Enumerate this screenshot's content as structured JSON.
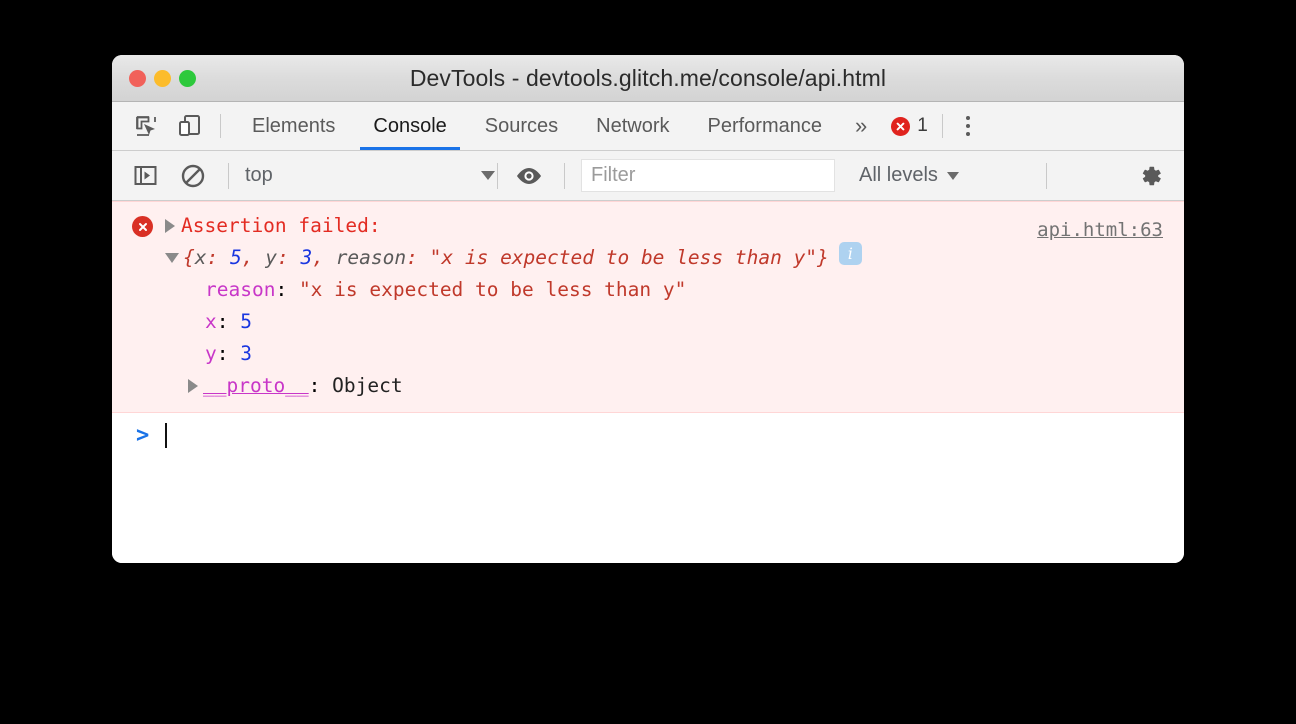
{
  "window": {
    "title": "DevTools - devtools.glitch.me/console/api.html",
    "traffic_lights": [
      "close",
      "minimize",
      "maximize"
    ],
    "colors": {
      "close": "#f1615a",
      "minimize": "#fcbc2b",
      "maximize": "#2dc93c",
      "accent": "#1a73e8",
      "error_red": "#e32b22",
      "error_bg": "#fff0f0",
      "property_purple": "#c836c8",
      "number_blue": "#1a36e0",
      "string_red": "#c0392b"
    }
  },
  "tabbar": {
    "inspect_icon": "inspect-element-icon",
    "device_icon": "device-toolbar-icon",
    "tabs": [
      {
        "label": "Elements",
        "active": false
      },
      {
        "label": "Console",
        "active": true
      },
      {
        "label": "Sources",
        "active": false
      },
      {
        "label": "Network",
        "active": false
      },
      {
        "label": "Performance",
        "active": false
      }
    ],
    "more_tabs": "»",
    "error_count": "1",
    "menu_icon": "kebab-menu-icon"
  },
  "console_toolbar": {
    "sidebar_icon": "console-sidebar-icon",
    "clear_icon": "clear-console-icon",
    "context": "top",
    "eye_icon": "live-expression-eye-icon",
    "filter_placeholder": "Filter",
    "filter_value": "",
    "levels": "All levels",
    "settings_icon": "gear-icon"
  },
  "console": {
    "message": {
      "icon": "error-circle-icon",
      "title": "Assertion failed:",
      "source": "api.html:63",
      "preview": {
        "open": "{",
        "close": "}",
        "entries": [
          {
            "key": "x",
            "value": "5",
            "type": "number"
          },
          {
            "key": "y",
            "value": "3",
            "type": "number"
          },
          {
            "key": "reason",
            "value": "\"x is expected to be less than y\"",
            "type": "string"
          }
        ],
        "info_badge": "i"
      },
      "properties": [
        {
          "key": "reason",
          "value": "\"x is expected to be less than y\"",
          "type": "string"
        },
        {
          "key": "x",
          "value": "5",
          "type": "number"
        },
        {
          "key": "y",
          "value": "3",
          "type": "number"
        }
      ],
      "proto": {
        "key": "__proto__",
        "value": "Object"
      }
    },
    "prompt": {
      "chevron": ">",
      "value": ""
    }
  }
}
